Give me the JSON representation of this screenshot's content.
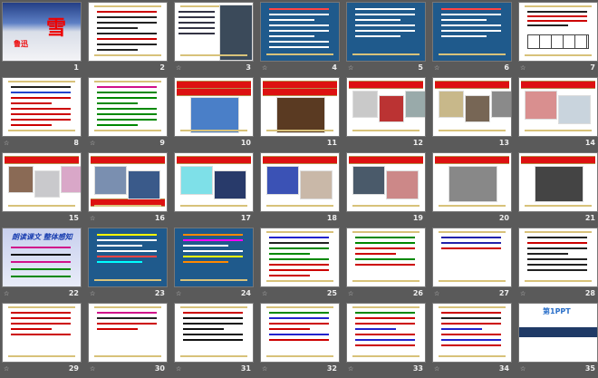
{
  "view": "slide-sorter",
  "colors": {
    "background": "#5a5a5a",
    "blue_slide": "#1f5a8c",
    "red": "#dd1111",
    "gold": "#d8c27a"
  },
  "slides": [
    {
      "n": "1",
      "transition": false,
      "theme": "title",
      "title": "雪",
      "subtitle": "鲁迅"
    },
    {
      "n": "2",
      "transition": false,
      "theme": "text",
      "lines": [
        "#c00",
        "#222",
        "#222",
        "#222",
        "#222",
        "#c00",
        "#222",
        "#222"
      ]
    },
    {
      "n": "3",
      "transition": true,
      "theme": "photo-text",
      "photos": [
        "#3b4a5a"
      ],
      "lines": [
        "#334",
        "#334",
        "#334",
        "#334",
        "#334"
      ]
    },
    {
      "n": "4",
      "transition": true,
      "theme": "blue",
      "lines": [
        "#f44",
        "#fff",
        "#fff",
        "#fff",
        "#fff",
        "#fff",
        "#fff",
        "#fff"
      ]
    },
    {
      "n": "5",
      "transition": true,
      "theme": "blue",
      "lines": [
        "#fff",
        "#fff",
        "#fff",
        "#fff",
        "#fff",
        "#fff"
      ]
    },
    {
      "n": "6",
      "transition": true,
      "theme": "blue",
      "lines": [
        "#f44",
        "#fff",
        "#fff",
        "#fff",
        "#fff",
        "#fff"
      ]
    },
    {
      "n": "7",
      "transition": true,
      "theme": "table",
      "lines": [
        "#222",
        "#c00",
        "#c00",
        "#222"
      ]
    },
    {
      "n": "8",
      "transition": true,
      "theme": "text",
      "lines": [
        "#222",
        "#2244cc",
        "#c00",
        "#c00",
        "#c00",
        "#c00",
        "#c00",
        "#c00"
      ]
    },
    {
      "n": "9",
      "transition": true,
      "theme": "text",
      "lines": [
        "#d0108a",
        "#080",
        "#080",
        "#080",
        "#080",
        "#080",
        "#080",
        "#080"
      ]
    },
    {
      "n": "10",
      "transition": false,
      "theme": "photos",
      "banners": 2,
      "photos": [
        "#4a7fc8"
      ]
    },
    {
      "n": "11",
      "transition": false,
      "theme": "photos",
      "banners": 2,
      "photos": [
        "#5a3a22"
      ]
    },
    {
      "n": "12",
      "transition": false,
      "theme": "photos",
      "banners": 1,
      "photos": [
        "#c9c9c9",
        "#b33",
        "#9aa"
      ]
    },
    {
      "n": "13",
      "transition": false,
      "theme": "photos",
      "banners": 1,
      "photos": [
        "#c8b88a",
        "#776655",
        "#8a8a8a"
      ]
    },
    {
      "n": "14",
      "transition": false,
      "theme": "photos",
      "banners": 1,
      "photos": [
        "#d98f8f",
        "#c9d4dd"
      ]
    },
    {
      "n": "15",
      "transition": false,
      "theme": "photos",
      "banners": 1,
      "photos": [
        "#8a6a55",
        "#c9c9cc",
        "#d9a7c8"
      ]
    },
    {
      "n": "16",
      "transition": true,
      "theme": "photos",
      "banners": 2,
      "photos": [
        "#7a8fb0",
        "#3a5a8a"
      ]
    },
    {
      "n": "17",
      "transition": false,
      "theme": "photos",
      "banners": 1,
      "photos": [
        "#7ee0e8",
        "#283a6a"
      ]
    },
    {
      "n": "18",
      "transition": false,
      "theme": "photos",
      "banners": 1,
      "photos": [
        "#3b52b5",
        "#c9b8a8"
      ]
    },
    {
      "n": "19",
      "transition": false,
      "theme": "photos",
      "banners": 1,
      "photos": [
        "#4a5a6a",
        "#c88"
      ]
    },
    {
      "n": "20",
      "transition": false,
      "theme": "photos",
      "banners": 1,
      "photos": [
        "#888"
      ]
    },
    {
      "n": "21",
      "transition": false,
      "theme": "photos",
      "banners": 1,
      "photos": [
        "#444"
      ]
    },
    {
      "n": "22",
      "transition": true,
      "theme": "reading",
      "title": "朗读课文  整体感知",
      "lines": [
        "#d0108a",
        "#111",
        "#d0108a",
        "#080",
        "#080"
      ]
    },
    {
      "n": "23",
      "transition": true,
      "theme": "blue",
      "lines": [
        "#ff0",
        "#fff",
        "#fff",
        "#fff",
        "#f44",
        "#0ff"
      ]
    },
    {
      "n": "24",
      "transition": true,
      "theme": "blue",
      "lines": [
        "#f80",
        "#f0f",
        "#fff",
        "#fff",
        "#ff0",
        "#f80"
      ]
    },
    {
      "n": "25",
      "transition": true,
      "theme": "text",
      "lines": [
        "#22c",
        "#222",
        "#080",
        "#080",
        "#080",
        "#c00",
        "#c00",
        "#c00"
      ]
    },
    {
      "n": "26",
      "transition": true,
      "theme": "text",
      "lines": [
        "#080",
        "#080",
        "#c00",
        "#c00",
        "#080",
        "#c00"
      ]
    },
    {
      "n": "27",
      "transition": true,
      "theme": "text",
      "lines": [
        "#22a",
        "#22a",
        "#c00"
      ]
    },
    {
      "n": "28",
      "transition": true,
      "theme": "text",
      "lines": [
        "#222",
        "#c00",
        "#222",
        "#222",
        "#222",
        "#222",
        "#222"
      ]
    },
    {
      "n": "29",
      "transition": true,
      "theme": "text",
      "lines": [
        "#c00",
        "#c00",
        "#c00",
        "#c00",
        "#c00"
      ]
    },
    {
      "n": "30",
      "transition": true,
      "theme": "text",
      "lines": [
        "#d0108a",
        "#222",
        "#c00",
        "#c00"
      ]
    },
    {
      "n": "31",
      "transition": true,
      "theme": "text",
      "lines": [
        "#c00",
        "#111",
        "#111",
        "#111",
        "#111",
        "#111"
      ]
    },
    {
      "n": "32",
      "transition": true,
      "theme": "text",
      "lines": [
        "#080",
        "#22c",
        "#c00",
        "#c00",
        "#22c",
        "#c00"
      ]
    },
    {
      "n": "33",
      "transition": true,
      "theme": "text",
      "lines": [
        "#080",
        "#c00",
        "#c00",
        "#22c",
        "#c00",
        "#22c",
        "#c00"
      ]
    },
    {
      "n": "34",
      "transition": true,
      "theme": "text",
      "lines": [
        "#c00",
        "#222",
        "#c00",
        "#22c",
        "#c00",
        "#22c",
        "#c00"
      ]
    },
    {
      "n": "35",
      "transition": true,
      "theme": "end",
      "title": "第1PPT"
    }
  ]
}
